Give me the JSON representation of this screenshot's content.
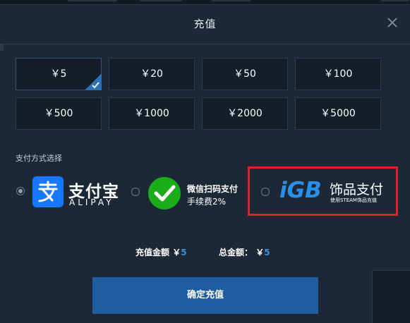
{
  "dialog": {
    "title": "充值",
    "close_icon": "close-icon"
  },
  "amounts": [
    {
      "label": "￥5",
      "selected": true
    },
    {
      "label": "￥20",
      "selected": false
    },
    {
      "label": "￥50",
      "selected": false
    },
    {
      "label": "￥100",
      "selected": false
    },
    {
      "label": "￥500",
      "selected": false
    },
    {
      "label": "￥1000",
      "selected": false
    },
    {
      "label": "￥2000",
      "selected": false
    },
    {
      "label": "￥5000",
      "selected": false
    }
  ],
  "payment": {
    "section_label": "支付方式选择",
    "alipay": {
      "name_cn": "支付宝",
      "name_en": "ALIPAY",
      "selected": true,
      "icon": "alipay-logo-icon"
    },
    "wechat": {
      "title": "微信扫码支付",
      "fee": "手续费2%",
      "selected": false,
      "icon": "wechat-logo-icon"
    },
    "igb": {
      "logo_text": "iGB",
      "name_cn": "饰品支付",
      "subtitle": "使用STEAM饰品充值",
      "selected": false,
      "icon": "igb-logo-icon"
    }
  },
  "totals": {
    "charge_label": "充值金额",
    "charge_currency": "￥",
    "charge_value": "5",
    "total_label": "总金额：",
    "total_currency": "￥",
    "total_value": "5"
  },
  "submit": {
    "label": "确定充值"
  },
  "colors": {
    "background": "#1d2836",
    "accent": "#1f5ca0",
    "highlight_number": "#3a8fe0",
    "alert_box": "#e0202a",
    "wechat_green": "#1aad19",
    "alipay_blue": "#1677ff",
    "igb_blue": "#2a8fe8"
  }
}
